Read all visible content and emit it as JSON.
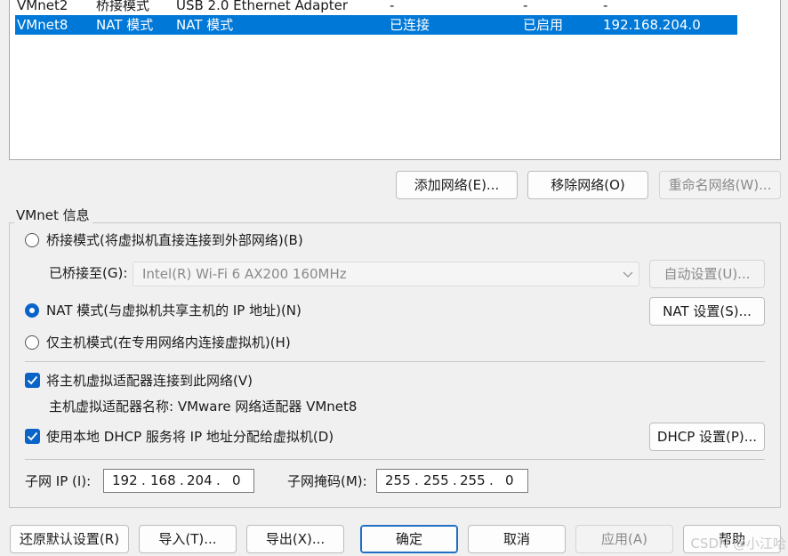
{
  "network_list": {
    "rows": [
      {
        "name": "VMnet2",
        "type": "桥接模式",
        "external": "USB 2.0 Ethernet Adapter",
        "host": "-",
        "dhcp": "-",
        "subnet": "-",
        "selected": false
      },
      {
        "name": "VMnet8",
        "type": "NAT 模式",
        "external": "NAT 模式",
        "host": "已连接",
        "dhcp": "已启用",
        "subnet": "192.168.204.0",
        "selected": true
      }
    ]
  },
  "list_buttons": {
    "add": "添加网络(E)...",
    "remove": "移除网络(O)",
    "rename": "重命名网络(W)..."
  },
  "vmnet_info": {
    "group_title": "VMnet 信息",
    "bridged": {
      "label": "桥接模式(将虚拟机直接连接到外部网络)(B)",
      "checked": false
    },
    "bridged_to": {
      "label": "已桥接至(G):",
      "value": "Intel(R) Wi-Fi 6 AX200 160MHz",
      "auto_button": "自动设置(U)..."
    },
    "nat": {
      "label": "NAT 模式(与虚拟机共享主机的 IP 地址)(N)",
      "checked": true,
      "settings_button": "NAT 设置(S)..."
    },
    "hostonly": {
      "label": "仅主机模式(在专用网络内连接虚拟机)(H)",
      "checked": false
    },
    "connect_adapter": {
      "label": "将主机虚拟适配器连接到此网络(V)",
      "checked": true
    },
    "adapter_name": "主机虚拟适配器名称: VMware 网络适配器 VMnet8",
    "dhcp": {
      "label": "使用本地 DHCP 服务将 IP 地址分配给虚拟机(D)",
      "checked": true,
      "settings_button": "DHCP 设置(P)..."
    },
    "subnet_ip": {
      "label": "子网 IP (I):",
      "octets": [
        "192",
        "168",
        "204",
        "0"
      ]
    },
    "subnet_mask": {
      "label": "子网掩码(M):",
      "octets": [
        "255",
        "255",
        "255",
        "0"
      ]
    }
  },
  "footer_buttons": {
    "restore": "还原默认设置(R)",
    "import": "导入(T)...",
    "export": "导出(X)...",
    "ok": "确定",
    "cancel": "取消",
    "apply": "应用(A)",
    "help": "帮助"
  },
  "watermark": "CSDN @小江哈",
  "colors": {
    "selection": "#0078d7",
    "accent": "#0a64c8",
    "window_bg": "#f0f0f0"
  }
}
